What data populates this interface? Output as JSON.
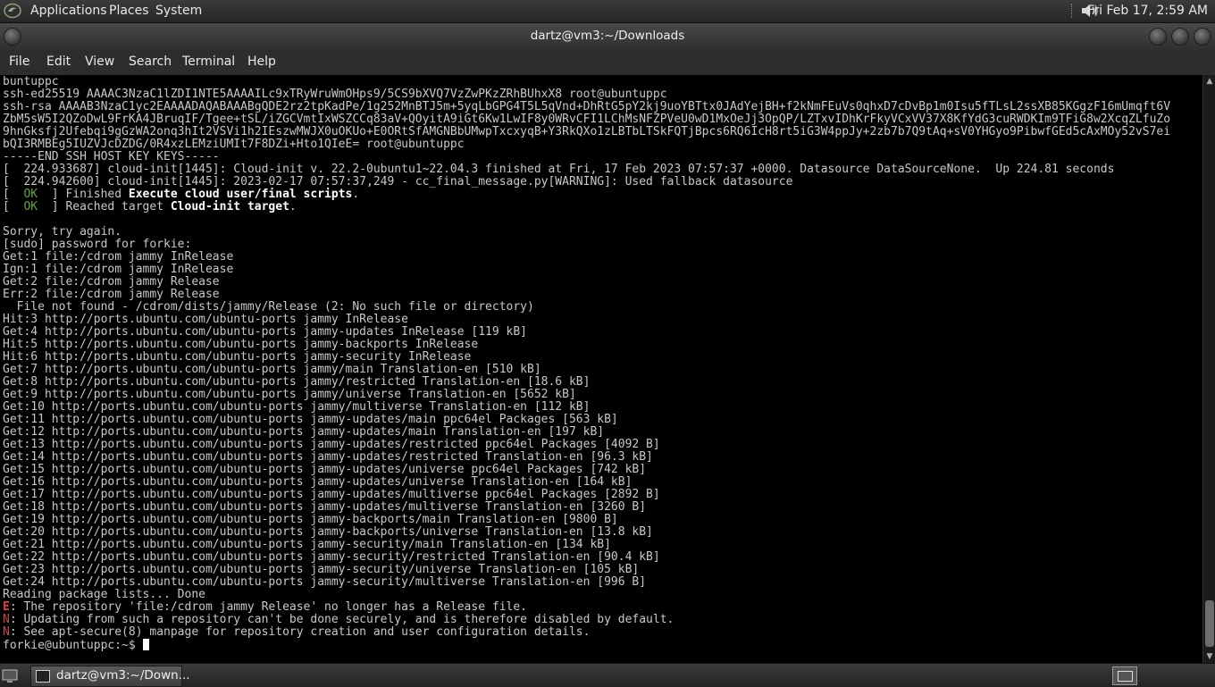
{
  "top_panel": {
    "menus": [
      "Applications",
      "Places",
      "System"
    ],
    "clock": "Fri Feb 17,  2:59 AM"
  },
  "window": {
    "title": "dartz@vm3:~/Downloads"
  },
  "menubar": {
    "items": [
      "File",
      "Edit",
      "View",
      "Search",
      "Terminal",
      "Help"
    ]
  },
  "terminal": {
    "lines": [
      {
        "t": "buntuppc"
      },
      {
        "t": "ssh-ed25519 AAAAC3NzaC1lZDI1NTE5AAAAILc9xTRyWruWmOHps9/5CS9bXVQ7VzZwPKzZRhBUhxX8 root@ubuntuppc"
      },
      {
        "t": "ssh-rsa AAAAB3NzaC1yc2EAAAADAQABAAABgQDE2rz2tpKadPe/1g252MnBTJ5m+5yqLbGPG4T5L5qVnd+DhRtG5pY2kj9uoYBTtx0JAdYejBH+f2kNmFEuVs0qhxD7cDvBp1m0Isu5fTLsL2ssXB85KGgzF16mUmqft6V"
      },
      {
        "t": "ZbM5sW5I2QZoDwL9FrKA4JBruqIF/Tgee+tSL/iZGCVmtIxWSZCCq83aV+QOyitA9iGt6Kw1LwIF8y0WRvCFI1LChMsNFZPVeU0wD1MxOeJj3OpQP/LZTxvIDhKrFkyVCxVV37X8KfYdG3cuRWDKIm9TFiG8w2XcqZLfuZo"
      },
      {
        "t": "9hnGksfj2Ufebqi9gGzWA2onq3hIt2VSVi1h2IEszwMWJX0uOKUo+E0ORtSfAMGNBbUMwpTxcxyqB+Y3RkQXo1zLBTbLTSkFQTjBpcs6RQ6IcH8rt5iG3W4ppJy+2zb7b7Q9tAq+sV0YHGyo9PibwfGEd5cAxMOy52vS7ei"
      },
      {
        "t": "bQI3RMBEg5IUZVJcDZDG/0R4xzLEMziUMIt7F8DZi+Hto1QIeE= root@ubuntuppc"
      },
      {
        "t": "-----END SSH HOST KEY KEYS-----"
      },
      {
        "t": "[  224.933687] cloud-init[1445]: Cloud-init v. 22.2-0ubuntu1~22.04.3 finished at Fri, 17 Feb 2023 07:57:37 +0000. Datasource DataSourceNone.  Up 224.81 seconds"
      },
      {
        "t": "[  224.942600] cloud-init[1445]: 2023-02-17 07:57:37,249 - cc_final_message.py[WARNING]: Used fallback datasource"
      },
      {
        "ok": true,
        "pre": "  ] Finished ",
        "b": "Execute cloud user/final scripts",
        "post": "."
      },
      {
        "ok": true,
        "pre": "  ] Reached target ",
        "b": "Cloud-init target",
        "post": "."
      },
      {
        "t": ""
      },
      {
        "t": "Sorry, try again."
      },
      {
        "t": "[sudo] password for forkie:"
      },
      {
        "t": "Get:1 file:/cdrom jammy InRelease"
      },
      {
        "t": "Ign:1 file:/cdrom jammy InRelease"
      },
      {
        "t": "Get:2 file:/cdrom jammy Release"
      },
      {
        "t": "Err:2 file:/cdrom jammy Release"
      },
      {
        "t": "  File not found - /cdrom/dists/jammy/Release (2: No such file or directory)"
      },
      {
        "t": "Hit:3 http://ports.ubuntu.com/ubuntu-ports jammy InRelease"
      },
      {
        "t": "Get:4 http://ports.ubuntu.com/ubuntu-ports jammy-updates InRelease [119 kB]"
      },
      {
        "t": "Hit:5 http://ports.ubuntu.com/ubuntu-ports jammy-backports InRelease"
      },
      {
        "t": "Hit:6 http://ports.ubuntu.com/ubuntu-ports jammy-security InRelease"
      },
      {
        "t": "Get:7 http://ports.ubuntu.com/ubuntu-ports jammy/main Translation-en [510 kB]"
      },
      {
        "t": "Get:8 http://ports.ubuntu.com/ubuntu-ports jammy/restricted Translation-en [18.6 kB]"
      },
      {
        "t": "Get:9 http://ports.ubuntu.com/ubuntu-ports jammy/universe Translation-en [5652 kB]"
      },
      {
        "t": "Get:10 http://ports.ubuntu.com/ubuntu-ports jammy/multiverse Translation-en [112 kB]"
      },
      {
        "t": "Get:11 http://ports.ubuntu.com/ubuntu-ports jammy-updates/main ppc64el Packages [563 kB]"
      },
      {
        "t": "Get:12 http://ports.ubuntu.com/ubuntu-ports jammy-updates/main Translation-en [197 kB]"
      },
      {
        "t": "Get:13 http://ports.ubuntu.com/ubuntu-ports jammy-updates/restricted ppc64el Packages [4092 B]"
      },
      {
        "t": "Get:14 http://ports.ubuntu.com/ubuntu-ports jammy-updates/restricted Translation-en [96.3 kB]"
      },
      {
        "t": "Get:15 http://ports.ubuntu.com/ubuntu-ports jammy-updates/universe ppc64el Packages [742 kB]"
      },
      {
        "t": "Get:16 http://ports.ubuntu.com/ubuntu-ports jammy-updates/universe Translation-en [164 kB]"
      },
      {
        "t": "Get:17 http://ports.ubuntu.com/ubuntu-ports jammy-updates/multiverse ppc64el Packages [2892 B]"
      },
      {
        "t": "Get:18 http://ports.ubuntu.com/ubuntu-ports jammy-updates/multiverse Translation-en [3260 B]"
      },
      {
        "t": "Get:19 http://ports.ubuntu.com/ubuntu-ports jammy-backports/main Translation-en [9800 B]"
      },
      {
        "t": "Get:20 http://ports.ubuntu.com/ubuntu-ports jammy-backports/universe Translation-en [13.8 kB]"
      },
      {
        "t": "Get:21 http://ports.ubuntu.com/ubuntu-ports jammy-security/main Translation-en [134 kB]"
      },
      {
        "t": "Get:22 http://ports.ubuntu.com/ubuntu-ports jammy-security/restricted Translation-en [90.4 kB]"
      },
      {
        "t": "Get:23 http://ports.ubuntu.com/ubuntu-ports jammy-security/universe Translation-en [105 kB]"
      },
      {
        "t": "Get:24 http://ports.ubuntu.com/ubuntu-ports jammy-security/multiverse Translation-en [996 B]"
      },
      {
        "t": "Reading package lists... Done"
      },
      {
        "tag": "E",
        "tag_class": "err",
        "t": ": The repository 'file:/cdrom jammy Release' no longer has a Release file."
      },
      {
        "tag": "N",
        "tag_class": "note",
        "t": ": Updating from such a repository can't be done securely, and is therefore disabled by default."
      },
      {
        "tag": "N",
        "tag_class": "note",
        "t": ": See apt-secure(8) manpage for repository creation and user configuration details."
      },
      {
        "prompt": true,
        "t": "forkie@ubuntuppc:~$ "
      }
    ]
  },
  "taskbar": {
    "item_label": "dartz@vm3:~/Down..."
  },
  "colors": {
    "terminal_bg": "#000000",
    "terminal_fg": "#c8c8c8",
    "ok_green": "#5fa43a",
    "error_red": "#e23b3b"
  }
}
